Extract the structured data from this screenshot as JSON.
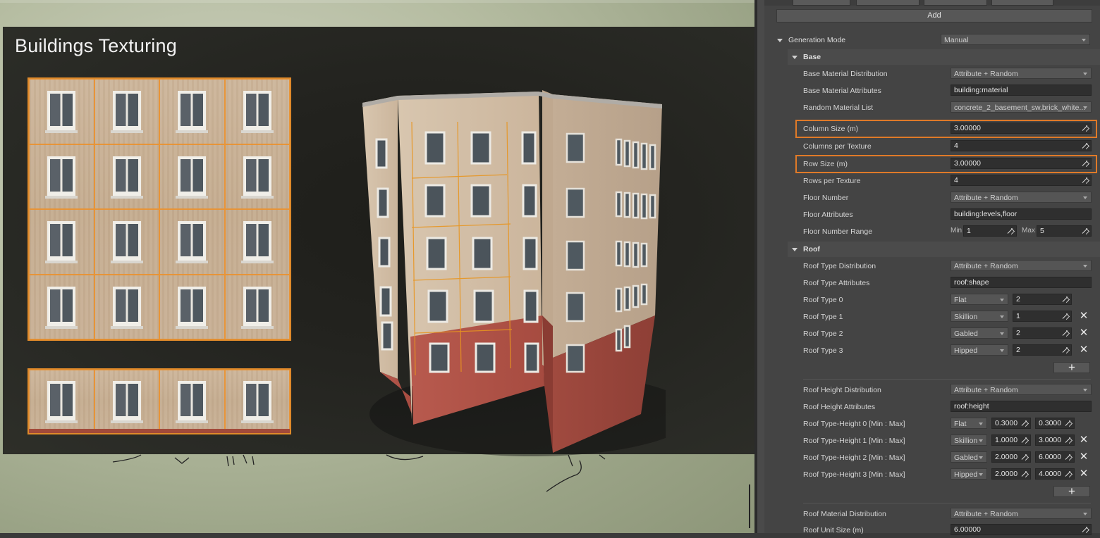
{
  "viewport": {
    "title": "Buildings Texturing"
  },
  "panel": {
    "add_label": "Add",
    "generation_mode": {
      "label": "Generation Mode",
      "value": "Manual"
    },
    "base": {
      "label": "Base",
      "rows": {
        "base_material_distribution": {
          "label": "Base Material Distribution",
          "value": "Attribute + Random"
        },
        "base_material_attributes": {
          "label": "Base Material Attributes",
          "value": "building:material"
        },
        "random_material_list": {
          "label": "Random Material List",
          "value": "concrete_2_basement_sw,brick_white..."
        },
        "column_size": {
          "label": "Column Size (m)",
          "value": "3.00000"
        },
        "columns_per_texture": {
          "label": "Columns per Texture",
          "value": "4"
        },
        "row_size": {
          "label": "Row Size (m)",
          "value": "3.00000"
        },
        "rows_per_texture": {
          "label": "Rows per Texture",
          "value": "4"
        },
        "floor_number": {
          "label": "Floor Number",
          "value": "Attribute + Random"
        },
        "floor_attributes": {
          "label": "Floor Attributes",
          "value": "building:levels,floor"
        },
        "floor_number_range": {
          "label": "Floor Number Range",
          "min_label": "Min",
          "min": "1",
          "max_label": "Max",
          "max": "5"
        }
      }
    },
    "roof": {
      "label": "Roof",
      "roof_type_distribution": {
        "label": "Roof Type Distribution",
        "value": "Attribute + Random"
      },
      "roof_type_attributes": {
        "label": "Roof Type Attributes",
        "value": "roof:shape"
      },
      "roof_types": [
        {
          "label": "Roof Type 0",
          "type": "Flat",
          "weight": "2"
        },
        {
          "label": "Roof Type 1",
          "type": "Skillion",
          "weight": "1"
        },
        {
          "label": "Roof Type 2",
          "type": "Gabled",
          "weight": "2"
        },
        {
          "label": "Roof Type 3",
          "type": "Hipped",
          "weight": "2"
        }
      ],
      "add_symbol": "+",
      "remove_symbol": "✕",
      "roof_height_distribution": {
        "label": "Roof Height Distribution",
        "value": "Attribute + Random"
      },
      "roof_height_attributes": {
        "label": "Roof Height Attributes",
        "value": "roof:height"
      },
      "roof_heights": [
        {
          "label": "Roof Type-Height 0 [Min : Max]",
          "type": "Flat",
          "min": "0.3000",
          "max": "0.3000"
        },
        {
          "label": "Roof Type-Height 1 [Min : Max]",
          "type": "Skillion",
          "min": "1.0000",
          "max": "3.0000"
        },
        {
          "label": "Roof Type-Height 2 [Min : Max]",
          "type": "Gabled",
          "min": "2.0000",
          "max": "6.0000"
        },
        {
          "label": "Roof Type-Height 3 [Min : Max]",
          "type": "Hipped",
          "min": "2.0000",
          "max": "4.0000"
        }
      ],
      "roof_material_distribution": {
        "label": "Roof Material Distribution",
        "value": "Attribute + Random"
      },
      "roof_unit_size": {
        "label": "Roof Unit Size (m)",
        "value": "6.00000"
      }
    },
    "colors": {
      "highlight": "#e07a28",
      "panel_bg": "#444444",
      "field_bg": "#2f2f2f"
    }
  }
}
